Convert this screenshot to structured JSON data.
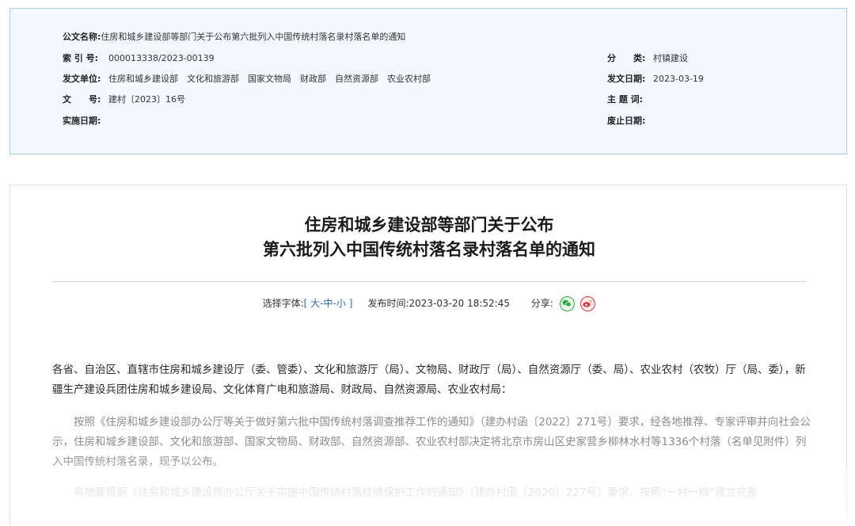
{
  "meta": {
    "doc_name_label": "公文名称:",
    "doc_name": "住房和城乡建设部等部门关于公布第六批列入中国传统村落名录村落名单的通知",
    "index_label": "索 引 号:",
    "index": "000013338/2023-00139",
    "category_label": "分　　类:",
    "category": "村镇建设",
    "issuer_label": "发文单位:",
    "issuers": "住房和城乡建设部　文化和旅游部　国家文物局　财政部　自然资源部　农业农村部",
    "issue_date_label": "发文日期:",
    "issue_date": "2023-03-19",
    "doc_no_label": "文　　号:",
    "doc_no": "建村〔2023〕16号",
    "subject_label": "主 题 词:",
    "subject": "",
    "effective_label": "实施日期:",
    "effective": "",
    "expiry_label": "废止日期:",
    "expiry": ""
  },
  "article": {
    "title_line1": "住房和城乡建设部等部门关于公布",
    "title_line2": "第六批列入中国传统村落名录村落名单的通知",
    "font_label": "选择字体:",
    "bracket_open": "[",
    "font_large": "大",
    "sep": "-",
    "font_medium": "中",
    "font_small": "小",
    "bracket_close": "]",
    "publish_label": "发布时间:",
    "publish_time": "2023-03-20 18:52:45",
    "share_label": "分享:",
    "share_icons": [
      "wechat-icon",
      "weibo-icon"
    ],
    "paragraphs": [
      "各省、自治区、直辖市住房和城乡建设厅（委、管委）、文化和旅游厅（局）、文物局、财政厅（局）、自然资源厅（委、局）、农业农村（农牧）厅（局、委），新疆生产建设兵团住房和城乡建设局、文化体育广电和旅游局、财政局、自然资源局、农业农村局：",
      "按照《住房和城乡建设部办公厅等关于做好第六批中国传统村落调查推荐工作的通知》（建办村函〔2022〕271号）要求，经各地推荐、专家评审并向社会公示，住房和城乡建设部、文化和旅游部、国家文物局、财政部、自然资源部、农业农村部决定将北京市房山区史家营乡柳林水村等1336个村落（名单见附件）列入中国传统村落名录，现予以公布。",
      "各地要根据《住房和城乡建设部办公厅关于实施中国传统村落挂牌保护工作的通知》（建办村函〔2020〕227号）要求，按照“一村一档”建立完善"
    ]
  }
}
